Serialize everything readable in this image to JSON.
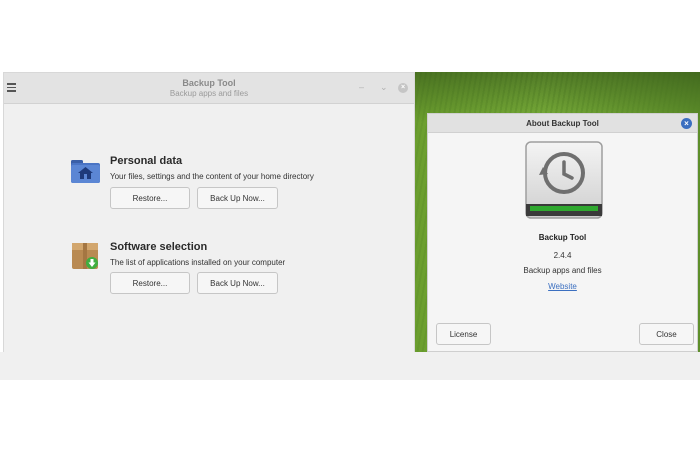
{
  "main_window": {
    "title": "Backup Tool",
    "subtitle": "Backup apps and files",
    "sections": [
      {
        "title": "Personal data",
        "description": "Your files, settings and the content of your home directory",
        "restore_label": "Restore...",
        "backup_label": "Back Up Now..."
      },
      {
        "title": "Software selection",
        "description": "The list of applications installed on your computer",
        "restore_label": "Restore...",
        "backup_label": "Back Up Now..."
      }
    ]
  },
  "about_dialog": {
    "title": "About Backup Tool",
    "app_name": "Backup Tool",
    "version": "2.4.4",
    "comments": "Backup apps and files",
    "website_label": "Website",
    "license_label": "License",
    "close_label": "Close"
  },
  "icons": {
    "menu": "hamburger-menu-icon",
    "personal_data": "home-folder-icon",
    "software": "package-icon",
    "logo": "backup-clock-icon"
  },
  "colors": {
    "accent": "#3b6fc0",
    "progress_green": "#2fa82f"
  }
}
